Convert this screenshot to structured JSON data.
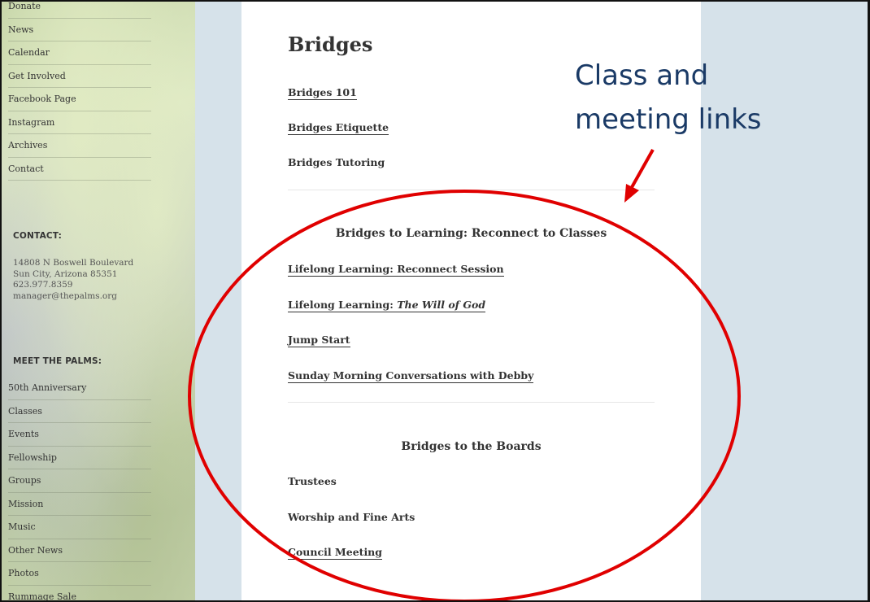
{
  "sidebar": {
    "nav_top": [
      "Donate",
      "News",
      "Calendar",
      "Get Involved",
      "Facebook Page",
      "Instagram",
      "Archives",
      "Contact"
    ],
    "contact_title": "CONTACT:",
    "contact_lines": [
      "14808 N Boswell Boulevard",
      "Sun City, Arizona 85351",
      "623.977.8359",
      "manager@thepalms.org"
    ],
    "meet_title": "MEET THE PALMS:",
    "meet_items": [
      "50th Anniversary",
      "Classes",
      "Events",
      "Fellowship",
      "Groups",
      "Mission",
      "Music",
      "Other News",
      "Photos",
      "Rummage Sale"
    ]
  },
  "main": {
    "title": "Bridges",
    "top_links": {
      "bridges_101": "Bridges 101",
      "etiquette": "Bridges Etiquette",
      "tutoring": "Bridges Tutoring"
    },
    "learning_heading": "Bridges to Learning: Reconnect to Classes",
    "learning_links": {
      "reconnect": "Lifelong Learning: Reconnect Session",
      "will_prefix": "Lifelong Learning: ",
      "will_italic": "The Will of God",
      "jump_start": "Jump Start",
      "debby": "Sunday Morning Conversations with Debby"
    },
    "boards_heading": "Bridges to the Boards",
    "boards_items": {
      "trustees": "Trustees",
      "worship": "Worship and Fine Arts",
      "council": "Council Meeting"
    }
  },
  "annotation": {
    "line1": "Class and",
    "line2": "meeting links",
    "color": "#e00000"
  }
}
